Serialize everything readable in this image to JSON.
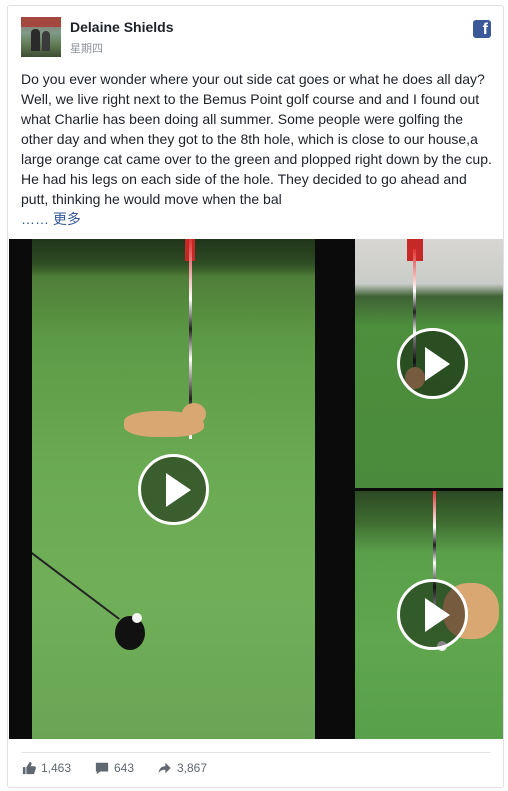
{
  "post": {
    "author": "Delaine Shields",
    "time": "星期四",
    "text": "Do you ever wonder where your out side cat goes or what he does all day? Well, we live right next to the Bemus Point golf course and and I found out what Charlie has been doing all summer. Some people were golfing the other day and when they got to the 8th hole, which is close to our house,a large orange cat came over to the green and plopped right down by the cup. He had his legs on each side of the hole. They decided to go ahead and putt, thinking he would move when the bal",
    "more_label": "…… 更多",
    "platform_icon": "facebook-logo-icon",
    "brand_color": "#3b5998"
  },
  "videos": [
    {
      "id": "video-main",
      "icon": "play-icon"
    },
    {
      "id": "video-top-right",
      "icon": "play-icon"
    },
    {
      "id": "video-bottom-right",
      "icon": "play-icon"
    }
  ],
  "stats": {
    "likes": "1,463",
    "comments": "643",
    "shares": "3,867",
    "like_icon": "thumbs-up-icon",
    "comment_icon": "comment-icon",
    "share_icon": "share-arrow-icon"
  }
}
